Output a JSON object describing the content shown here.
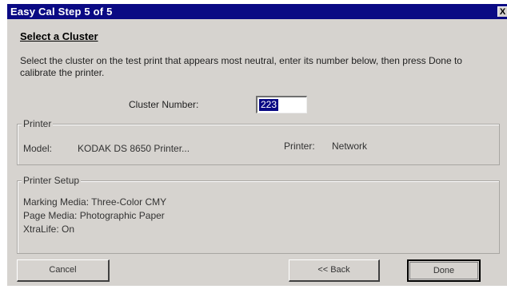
{
  "window": {
    "title": "Easy Cal Step 5 of 5",
    "close_label": "X"
  },
  "heading": "Select a Cluster",
  "instructions": "Select the cluster on the test print that appears most neutral, enter its number below, then press Done to calibrate the printer.",
  "cluster": {
    "label": "Cluster Number:",
    "value": "223"
  },
  "printer_group": {
    "label": "Printer",
    "model_label": "Model:",
    "model_value": "KODAK DS 8650 Printer...",
    "printer_label": "Printer:",
    "printer_value": "Network"
  },
  "setup_group": {
    "label": "Printer Setup",
    "lines": [
      "Marking Media: Three-Color CMY",
      "Page Media: Photographic Paper",
      "XtraLife: On"
    ]
  },
  "buttons": {
    "cancel": "Cancel",
    "back": "<< Back",
    "done": "Done"
  },
  "colors": {
    "titlebar": "#0a0a84",
    "dialog_bg": "#d6d3cf",
    "selection": "#0a0a84"
  }
}
